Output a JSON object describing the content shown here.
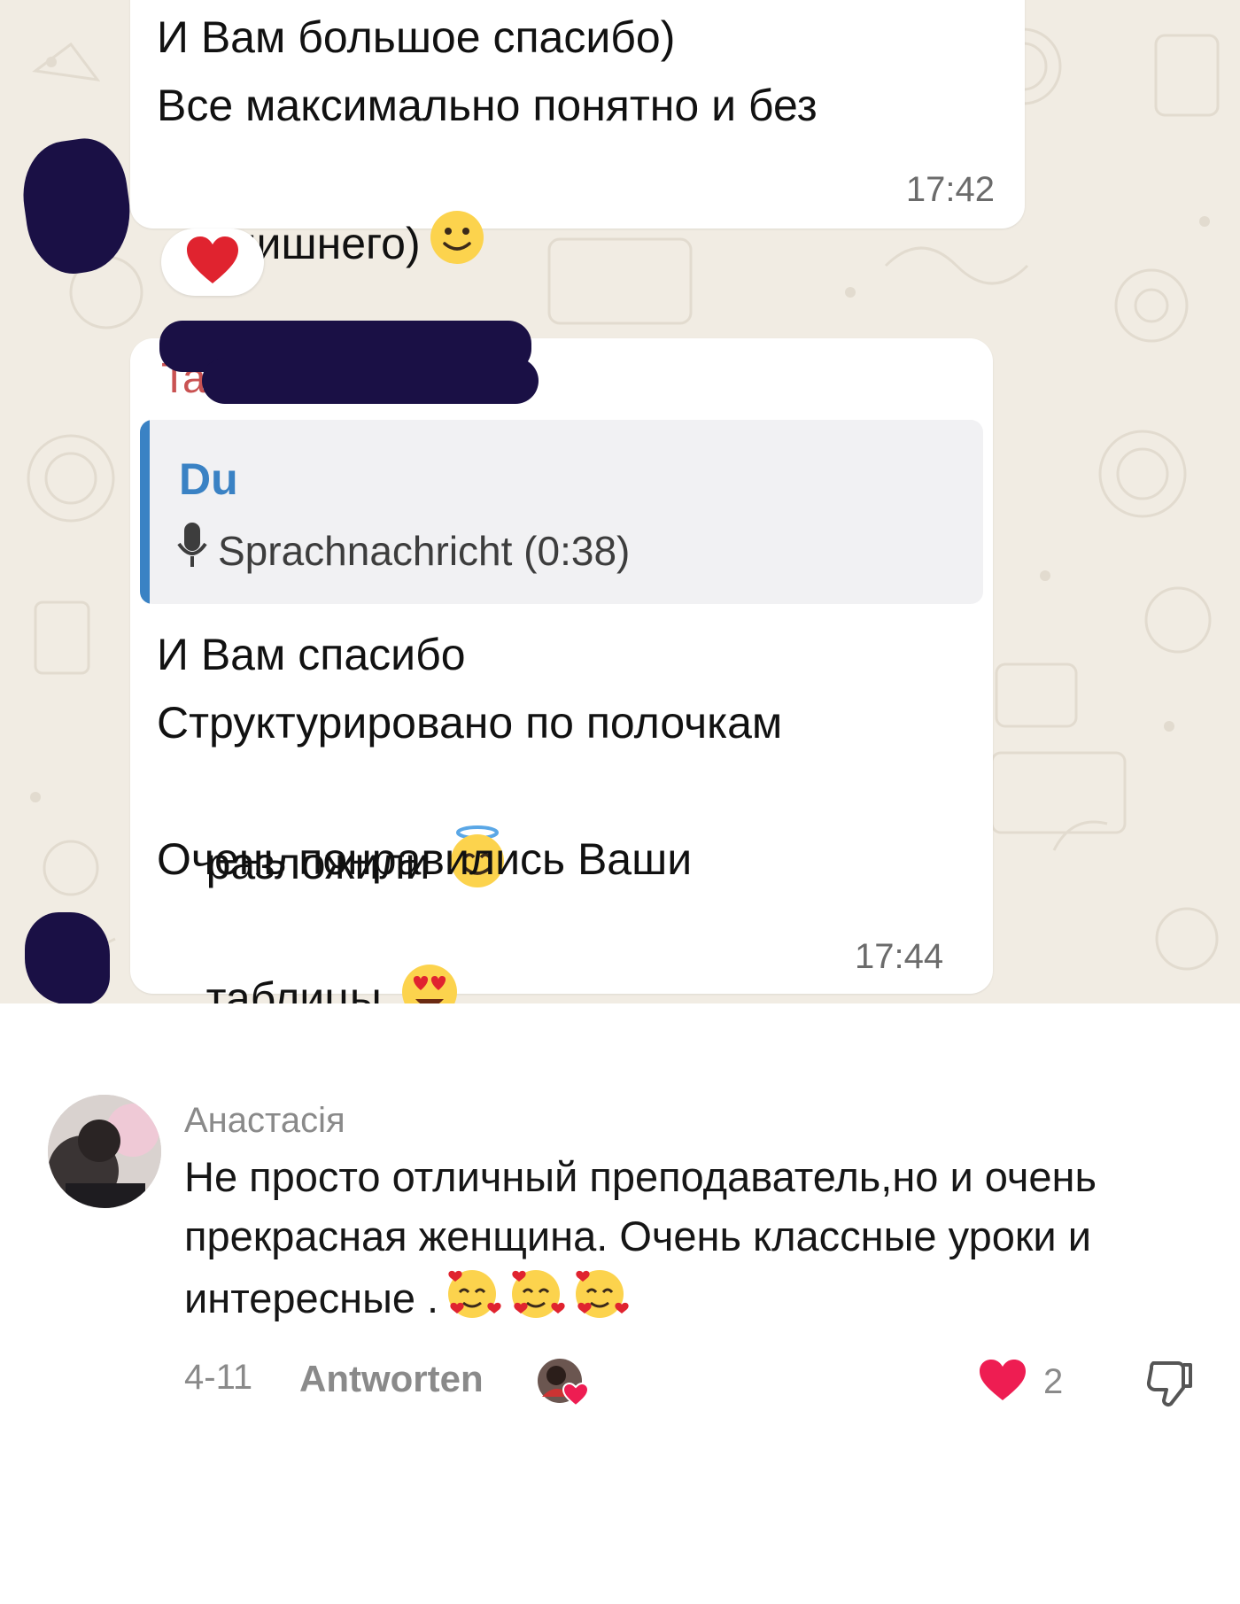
{
  "chat": {
    "message_1": {
      "lines": [
        "И Вам большое спасибо)",
        "Все максимально понятно и без",
        "лишнего)"
      ],
      "emoji": "slightly-smiling-face",
      "time": "17:42",
      "reaction": "heart"
    },
    "message_2": {
      "sender": "Tatiana Dibrova",
      "reply": {
        "sender": "Du",
        "icon": "microphone-icon",
        "text": "Sprachnachricht (0:38)"
      },
      "lines": [
        "И Вам спасибо",
        "Структурировано по полочкам",
        "разложили",
        "Очень понравились Ваши",
        "таблицы"
      ],
      "emojis": [
        "smiling-face-with-halo",
        "smiling-face-with-heart-eyes"
      ],
      "time": "17:44"
    },
    "colors": {
      "background": "#f1ece3",
      "bubble": "#ffffff",
      "quote_accent": "#3a82c4",
      "sender_name": "#c95252"
    }
  },
  "comment": {
    "author": "Анастасія",
    "text": "Не просто отличный преподаватель,но и очень прекрасная женщина. Очень классные уроки и интересные .",
    "emojis": [
      "smiling-face-with-hearts",
      "smiling-face-with-hearts",
      "smiling-face-with-hearts"
    ],
    "date": "4-11",
    "reply_label": "Antworten",
    "like_count": "2",
    "colors": {
      "like": "#ee1d52",
      "meta": "#8a8a8a"
    }
  }
}
